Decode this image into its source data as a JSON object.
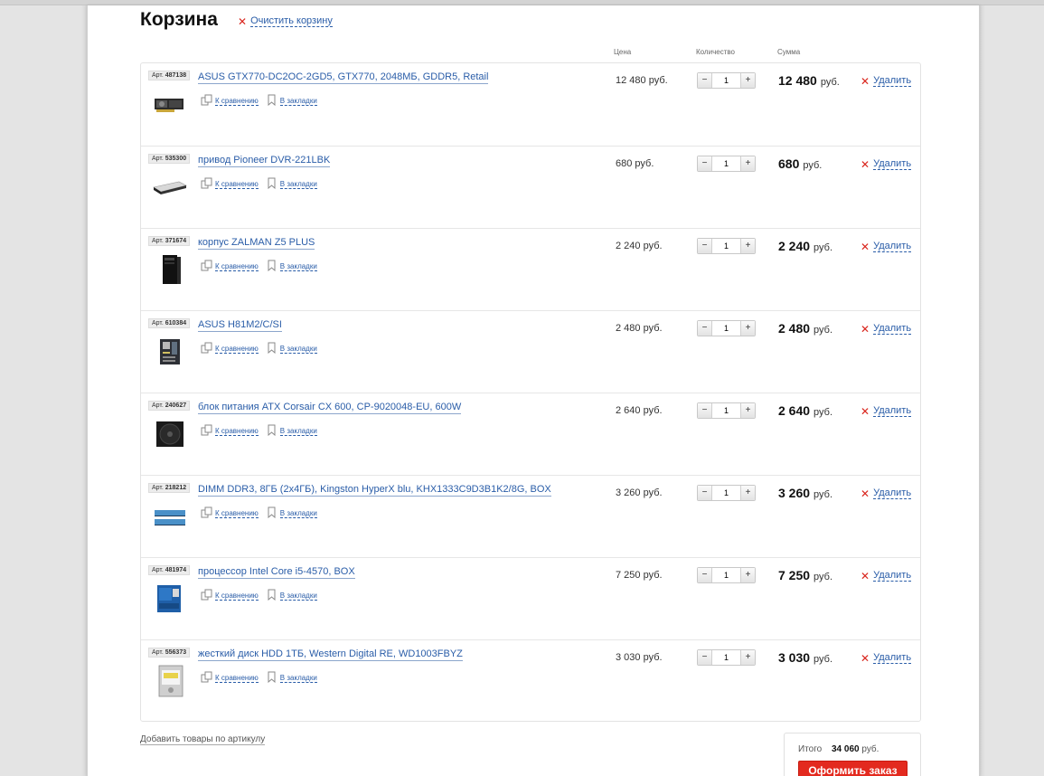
{
  "page": {
    "title": "Корзина",
    "clear_label": "Очистить корзину"
  },
  "columns": {
    "price": "Цена",
    "qty": "Количество",
    "sum": "Сумма"
  },
  "labels": {
    "art_prefix": "Арт.",
    "compare": "К сравнению",
    "bookmark": "В закладки",
    "delete": "Удалить",
    "currency": "руб.",
    "add_by_article": "Добавить товары по артикулу",
    "total_label": "Итого",
    "order_button": "Оформить заказ"
  },
  "total": {
    "value": "34 060",
    "currency": "руб."
  },
  "items": [
    {
      "art": "487138",
      "name": "ASUS GTX770-DC2OC-2GD5, GTX770, 2048МБ, GDDR5, Retail",
      "price": "12 480 руб.",
      "qty": "1",
      "sum": "12 480",
      "thumb": "gpu"
    },
    {
      "art": "535300",
      "name": "привод Pioneer DVR-221LBK",
      "price": "680 руб.",
      "qty": "1",
      "sum": "680",
      "thumb": "dvd"
    },
    {
      "art": "371674",
      "name": "корпус ZALMAN Z5 PLUS",
      "price": "2 240 руб.",
      "qty": "1",
      "sum": "2 240",
      "thumb": "case"
    },
    {
      "art": "610384",
      "name": "ASUS H81M2/C/SI",
      "price": "2 480 руб.",
      "qty": "1",
      "sum": "2 480",
      "thumb": "mobo"
    },
    {
      "art": "240627",
      "name": "блок питания ATX Corsair CX 600, CP-9020048-EU, 600W",
      "price": "2 640 руб.",
      "qty": "1",
      "sum": "2 640",
      "thumb": "psu"
    },
    {
      "art": "218212",
      "name": "DIMM DDR3, 8ГБ (2x4ГБ), Kingston HyperX blu, KHX1333C9D3B1K2/8G, BOX",
      "price": "3 260 руб.",
      "qty": "1",
      "sum": "3 260",
      "thumb": "ram"
    },
    {
      "art": "481974",
      "name": "процессор Intel Core i5-4570, BOX",
      "price": "7 250 руб.",
      "qty": "1",
      "sum": "7 250",
      "thumb": "cpu"
    },
    {
      "art": "556373",
      "name": "жесткий диск HDD 1ТБ, Western Digital RE, WD1003FBYZ",
      "price": "3 030 руб.",
      "qty": "1",
      "sum": "3 030",
      "thumb": "hdd"
    }
  ]
}
